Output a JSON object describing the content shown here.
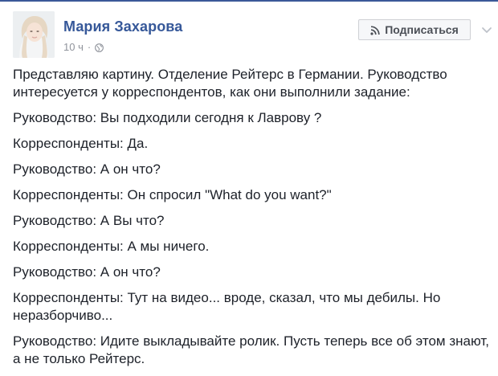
{
  "author": {
    "name": "Мария Захарова",
    "time": "10 ч",
    "separator": "·",
    "privacy_icon": "globe-icon"
  },
  "actions": {
    "subscribe_label": "Подписаться",
    "subscribe_icon": "rss-icon",
    "menu_icon": "chevron-down-icon"
  },
  "post": {
    "paragraphs": [
      "Представляю картину. Отделение Рейтерс в Германии. Руководство интересуется у корреспондентов, как они выполнили задание:",
      "Руководство: Вы подходили сегодня к Лаврову ?",
      "Корреспонденты: Да.",
      "Руководство: А он что?",
      "Корреспонденты: Он спросил \"What do you want?\"",
      "Руководство: А Вы что?",
      "Корреспонденты: А мы ничего.",
      "Руководство: А он что?",
      "Корреспонденты: Тут на видео... вроде, сказал, что мы дебилы. Но неразборчиво...",
      "Руководство: Идите выкладывайте ролик. Пусть теперь все об этом знают, а не только Рейтерс."
    ]
  },
  "colors": {
    "name_link": "#365899",
    "meta_text": "#90949c",
    "body_text": "#1d2129",
    "button_bg": "#f6f7f9",
    "button_border": "#ced0d4",
    "button_text": "#4b4f56"
  }
}
